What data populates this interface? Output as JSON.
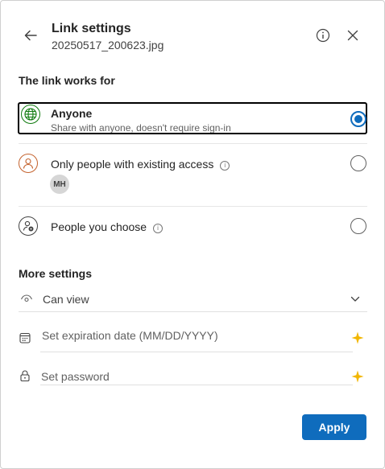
{
  "header": {
    "title": "Link settings",
    "file_name": "20250517_200623.jpg",
    "back_icon": "arrow-left-icon",
    "info_icon": "info-icon",
    "close_icon": "close-icon"
  },
  "link_works_for": {
    "heading": "The link works for",
    "options": [
      {
        "title": "Anyone",
        "description": "Share with anyone, doesn't require sign-in",
        "icon": "globe-icon",
        "selected": true
      },
      {
        "title": "Only people with existing access",
        "icon": "person-icon",
        "avatar_initials": "MH",
        "selected": false
      },
      {
        "title": "People you choose",
        "icon": "people-settings-icon",
        "selected": false
      }
    ]
  },
  "more_settings": {
    "heading": "More settings",
    "permission": {
      "value": "Can view",
      "icon": "eye-icon"
    },
    "expiration": {
      "placeholder": "Set expiration date (MM/DD/YYYY)",
      "icon": "calendar-icon"
    },
    "password": {
      "placeholder": "Set password",
      "icon": "lock-icon"
    },
    "sparkle_icon": "sparkle-icon"
  },
  "footer": {
    "apply_label": "Apply"
  },
  "colors": {
    "accent": "#0f6cbd",
    "sparkle": "#f2b600",
    "globe": "#0e7a0d",
    "person": "#c4622d"
  }
}
